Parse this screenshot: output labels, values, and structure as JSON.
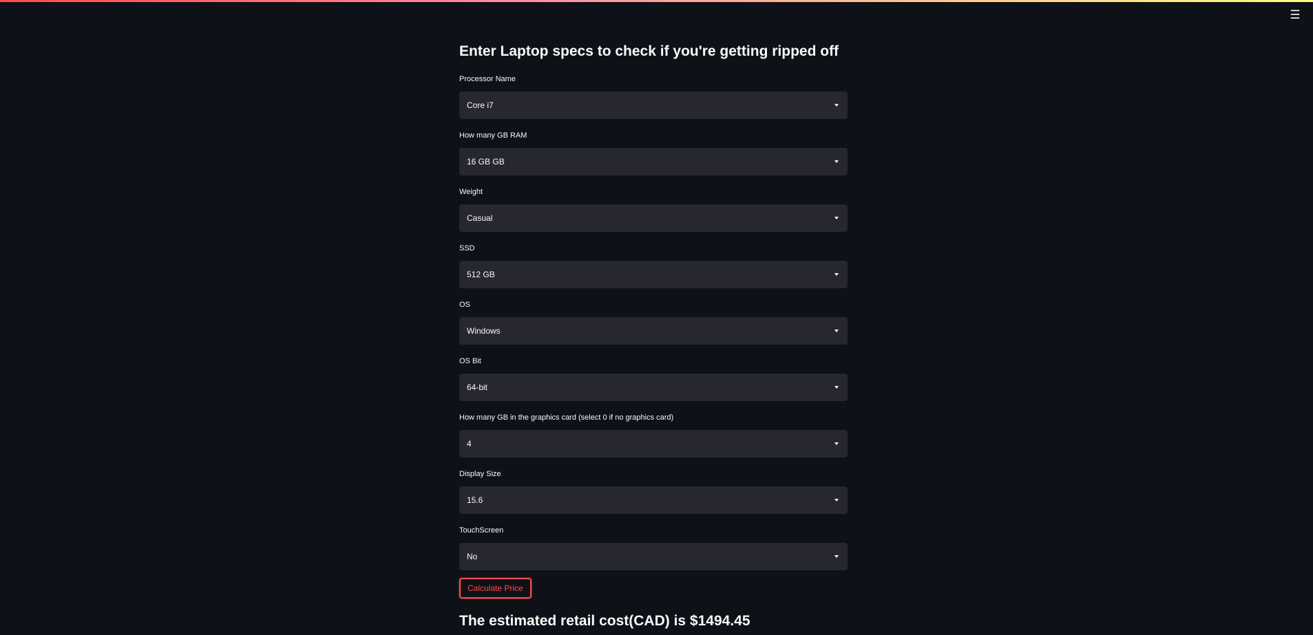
{
  "header": {
    "menu_icon": "☰"
  },
  "form": {
    "title": "Enter Laptop specs to check if you're getting ripped off",
    "fields": [
      {
        "label": "Processor Name",
        "value": "Core i7"
      },
      {
        "label": "How many GB RAM",
        "value": "16 GB GB"
      },
      {
        "label": "Weight",
        "value": "Casual"
      },
      {
        "label": "SSD",
        "value": "512 GB"
      },
      {
        "label": "OS",
        "value": "Windows"
      },
      {
        "label": "OS Bit",
        "value": "64-bit"
      },
      {
        "label": "How many GB in the graphics card (select 0 if no graphics card)",
        "value": "4"
      },
      {
        "label": "Display Size",
        "value": "15.6"
      },
      {
        "label": "TouchScreen",
        "value": "No"
      }
    ],
    "button_label": "Calculate Price",
    "result": "The estimated retail cost(CAD) is $1494.45"
  },
  "colors": {
    "background": "#0e1117",
    "select_bg": "#262730",
    "accent": "#ff4b4b",
    "text": "#fafafa"
  }
}
